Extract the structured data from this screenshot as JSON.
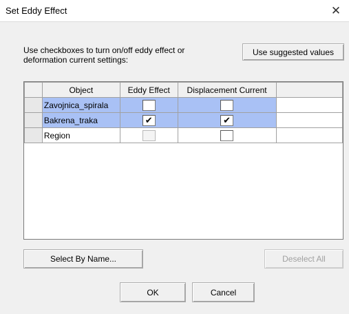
{
  "window": {
    "title": "Set Eddy Effect",
    "close_glyph": "✕"
  },
  "instruction": "Use checkboxes to turn on/off eddy effect or deformation current settings:",
  "buttons": {
    "use_suggested": "Use suggested values",
    "select_by_name": "Select By Name...",
    "deselect_all": "Deselect All",
    "ok": "OK",
    "cancel": "Cancel"
  },
  "table": {
    "columns": [
      "Object",
      "Eddy Effect",
      "Displacement Current"
    ],
    "rows": [
      {
        "object": "Zavojnica_spirala",
        "eddy": false,
        "displacement": false,
        "selected": true,
        "eddy_enabled": true
      },
      {
        "object": "Bakrena_traka",
        "eddy": true,
        "displacement": true,
        "selected": true,
        "eddy_enabled": true
      },
      {
        "object": "Region",
        "eddy": false,
        "displacement": false,
        "selected": false,
        "eddy_enabled": false
      }
    ]
  },
  "colors": {
    "selection": "#a9c1f5",
    "background": "#f0f0f0"
  },
  "icons": {
    "check": "check-mark-icon",
    "close": "close-icon"
  }
}
